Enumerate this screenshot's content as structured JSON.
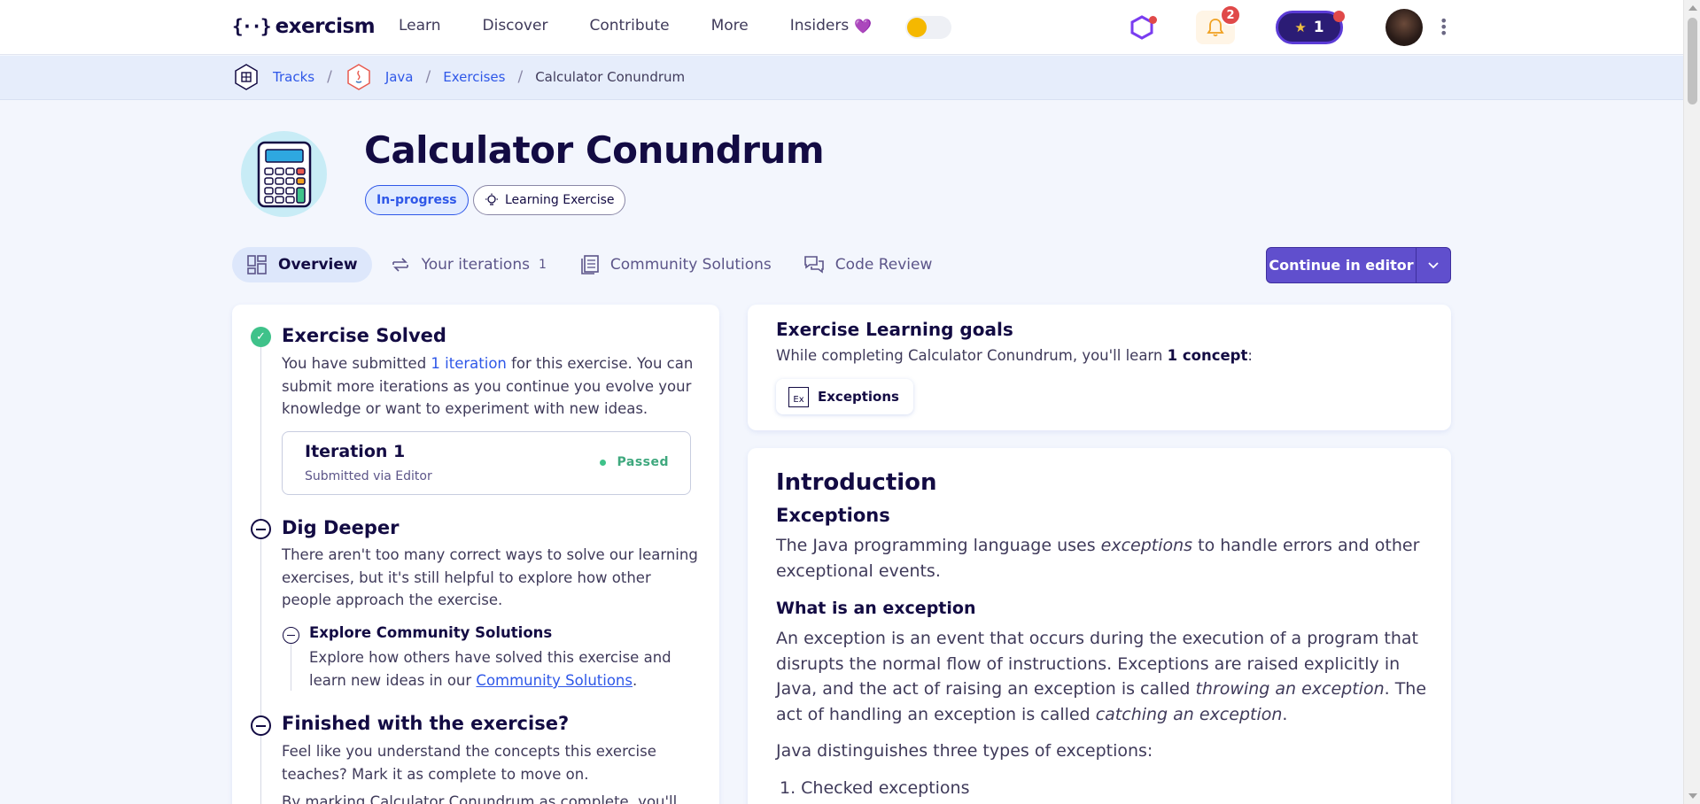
{
  "header": {
    "logo_mark": "{··}",
    "logo_text": "exercism",
    "nav": [
      "Learn",
      "Discover",
      "Contribute",
      "More",
      "Insiders"
    ],
    "notification_count": "2",
    "reputation": "1"
  },
  "breadcrumb": {
    "tracks": "Tracks",
    "track": "Java",
    "exercises": "Exercises",
    "current": "Calculator Conundrum",
    "separator": "/"
  },
  "exercise": {
    "title": "Calculator Conundrum",
    "status_pill": "In-progress",
    "type_pill": "Learning Exercise"
  },
  "tabs": [
    {
      "label": "Overview"
    },
    {
      "label": "Your iterations",
      "count": "1"
    },
    {
      "label": "Community Solutions"
    },
    {
      "label": "Code Review"
    }
  ],
  "cta": {
    "label": "Continue in editor"
  },
  "left": {
    "solved_title": "Exercise Solved",
    "solved_text_a": "You have submitted ",
    "solved_link": "1 iteration",
    "solved_text_b": " for this exercise. You can submit more iterations as you continue you evolve your knowledge or want to experiment with new ideas.",
    "iteration_title": "Iteration 1",
    "iteration_sub": "Submitted via Editor",
    "iteration_status": "Passed",
    "dig_title": "Dig Deeper",
    "dig_text": "There aren't too many correct ways to solve our learning exercises, but it's still helpful to explore how other people approach the exercise.",
    "explore_title": "Explore Community Solutions",
    "explore_text_a": "Explore how others have solved this exercise and learn new ideas in our ",
    "explore_link": "Community Solutions",
    "explore_text_b": ".",
    "finished_title": "Finished with the exercise?",
    "finished_text": "Feel like you understand the concepts this exercise teaches? Mark it as complete to move on.",
    "finished_cutoff": "By marking Calculator Conundrum as complete, you'll"
  },
  "goals": {
    "title": "Exercise Learning goals",
    "text_a": "While completing Calculator Conundrum, you'll learn ",
    "text_bold": "1 concept",
    "text_b": ":",
    "concept_icon": "Ex",
    "concept_label": "Exceptions"
  },
  "intro": {
    "h1": "Introduction",
    "h2": "Exceptions",
    "p1_a": "The Java programming language uses ",
    "p1_em": "exceptions",
    "p1_b": " to handle errors and other exceptional events.",
    "h3": "What is an exception",
    "p2_a": "An exception is an event that occurs during the execution of a program that disrupts the normal flow of instructions. Exceptions are raised explicitly in Java, and the act of raising an exception is called ",
    "p2_em1": "throwing an exception",
    "p2_b": ". The act of handling an exception is called ",
    "p2_em2": "catching an exception",
    "p2_c": ".",
    "p3": "Java distinguishes three types of exceptions:",
    "li1": "1.  Checked exceptions"
  },
  "colors": {
    "accent": "#604fcd",
    "link": "#2e57e8",
    "success": "#3fc28a",
    "alert": "#e04949"
  }
}
